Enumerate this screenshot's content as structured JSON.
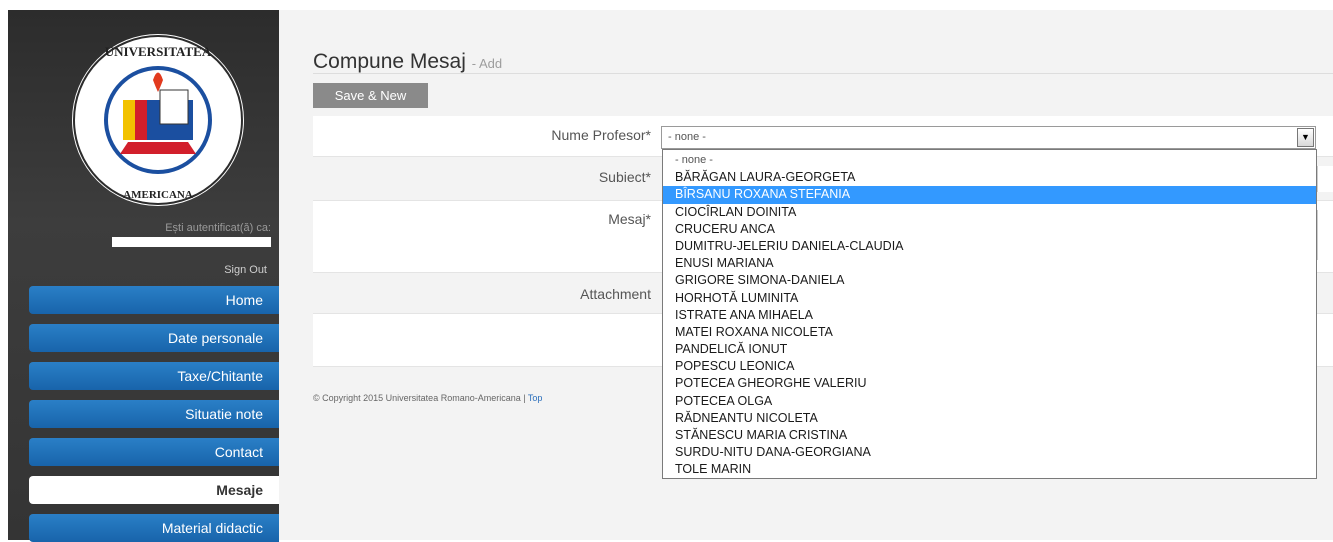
{
  "sidebar": {
    "auth_label": "Ești autentificat(ă) ca:",
    "sign_out": "Sign Out",
    "nav": [
      {
        "label": "Home"
      },
      {
        "label": "Date personale"
      },
      {
        "label": "Taxe/Chitante"
      },
      {
        "label": "Situatie note"
      },
      {
        "label": "Contact"
      },
      {
        "label": "Mesaje"
      },
      {
        "label": "Material didactic"
      }
    ],
    "active": "Mesaje"
  },
  "page": {
    "title": "Compune Mesaj",
    "subtitle": "- Add",
    "save_button": "Save & New"
  },
  "form": {
    "profesor_label": "Nume Profesor*",
    "profesor_value": "- none -",
    "subiect_label": "Subiect*",
    "mesaj_label": "Mesaj*",
    "attachment_label": "Attachment"
  },
  "dropdown": {
    "selected_index": 2,
    "options": [
      "- none -",
      "BĂRĂGAN LAURA-GEORGETA",
      "BÎRSANU ROXANA STEFANIA",
      "CIOCÎRLAN DOINITA",
      "CRUCERU ANCA",
      "DUMITRU-JELERIU DANIELA-CLAUDIA",
      "ENUSI MARIANA",
      "GRIGORE SIMONA-DANIELA",
      "HORHOTĂ LUMINITA",
      "ISTRATE ANA MIHAELA",
      "MATEI ROXANA NICOLETA",
      "PANDELICĂ IONUT",
      "POPESCU LEONICA",
      "POTECEA GHEORGHE VALERIU",
      "POTECEA OLGA",
      "RĂDNEANTU NICOLETA",
      "STĂNESCU MARIA CRISTINA",
      "SURDU-NITU DANA-GEORGIANA",
      "TOLE MARIN"
    ]
  },
  "footer": {
    "copyright": "© Copyright 2015 Universitatea Romano-Americana |",
    "top_link": "Top"
  },
  "colors": {
    "nav_blue": "#1f72bb",
    "highlight": "#3399ff"
  }
}
